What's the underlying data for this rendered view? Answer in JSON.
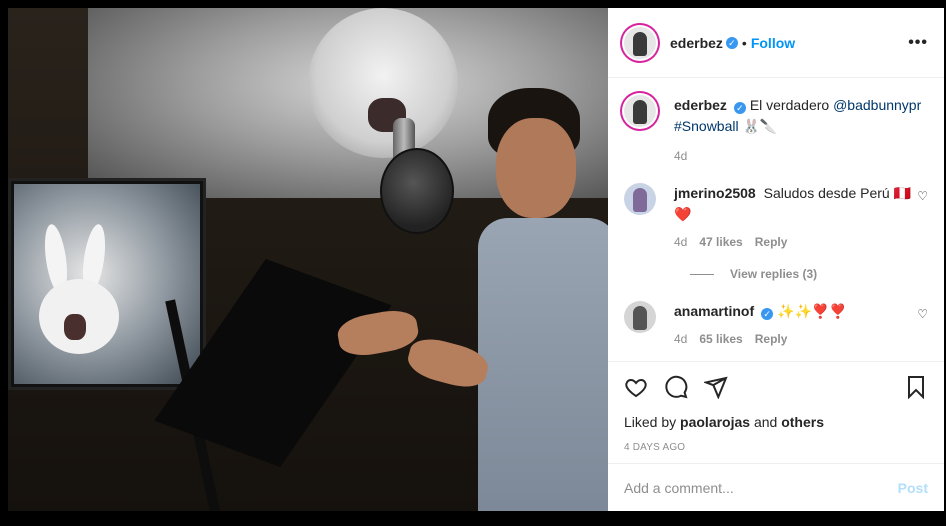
{
  "post": {
    "author": "ederbez",
    "follow_label": "Follow",
    "more_icon": "more-dots-icon"
  },
  "caption": {
    "username": "ederbez",
    "text_before": "El verdadero ",
    "mention": "@badbunnypr",
    "hashtag": "#Snowball",
    "emoji": "🐰🔪",
    "time": "4d"
  },
  "comments": [
    {
      "username": "jmerino2508",
      "text": "Saludos desde Perú",
      "emoji": "🇵🇪❤️",
      "time": "4d",
      "likes": "47 likes",
      "reply_label": "Reply",
      "view_replies": "View replies (3)"
    },
    {
      "username": "anamartinof",
      "text": "✨✨❣️❣️",
      "time": "4d",
      "likes": "65 likes",
      "reply_label": "Reply"
    }
  ],
  "actions": {
    "liked_by_prefix": "Liked by ",
    "liked_by_user": "paolarojas",
    "liked_by_and": " and ",
    "liked_by_others": "others",
    "date": "4 DAYS AGO"
  },
  "add_comment": {
    "placeholder": "Add a comment...",
    "post_label": "Post"
  },
  "colors": {
    "accent": "#0095f6",
    "post_disabled": "#b2dffc",
    "hashtag": "#00376b",
    "muted": "#8e8e8e"
  }
}
